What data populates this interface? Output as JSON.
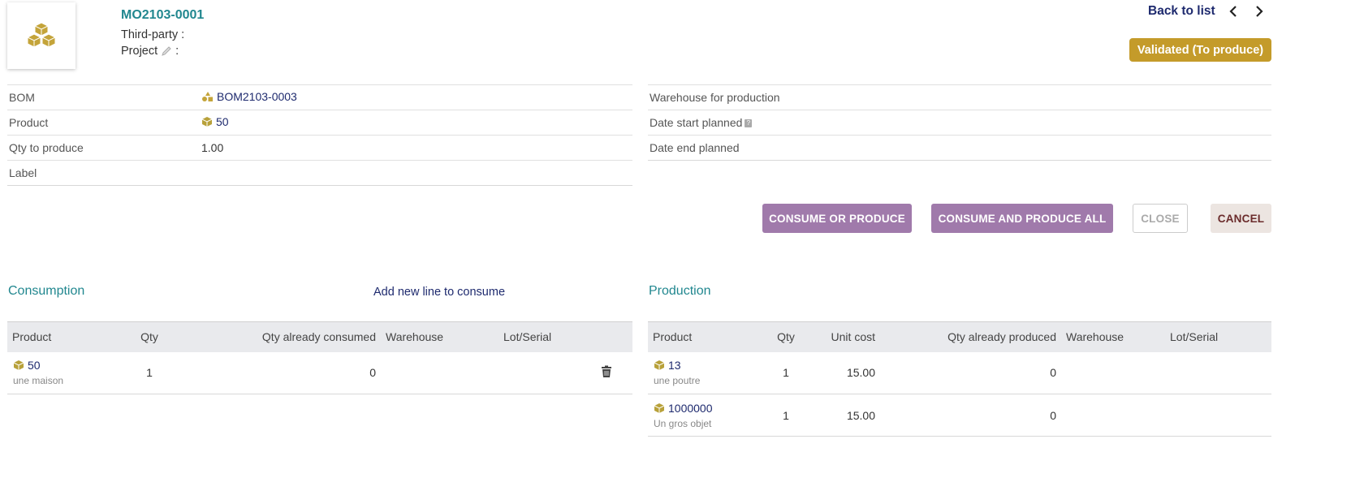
{
  "header": {
    "ref": "MO2103-0001",
    "third_party_label": "Third-party :",
    "project_label": "Project",
    "project_colon": ":",
    "back_to_list": "Back to list",
    "status": "Validated (To produce)"
  },
  "fields_left": {
    "bom": {
      "label": "BOM",
      "value": "BOM2103-0003"
    },
    "product": {
      "label": "Product",
      "value": "50"
    },
    "qty": {
      "label": "Qty to produce",
      "value": "1.00"
    },
    "label": {
      "label": "Label",
      "value": ""
    }
  },
  "fields_right": {
    "warehouse": {
      "label": "Warehouse for production",
      "value": ""
    },
    "date_start": {
      "label": "Date start planned",
      "value": "",
      "help": "?"
    },
    "date_end": {
      "label": "Date end planned",
      "value": ""
    }
  },
  "actions": {
    "consume": "CONSUME OR PRODUCE",
    "consume_all": "CONSUME AND PRODUCE ALL",
    "close": "CLOSE",
    "cancel": "CANCEL"
  },
  "consumption": {
    "title": "Consumption",
    "add_line": "Add new line to consume",
    "headers": {
      "product": "Product",
      "qty": "Qty",
      "consumed": "Qty already consumed",
      "warehouse": "Warehouse",
      "lot": "Lot/Serial"
    },
    "rows": [
      {
        "product": "50",
        "desc": "une maison",
        "qty": "1",
        "consumed": "0",
        "warehouse": "",
        "lot": ""
      }
    ]
  },
  "production": {
    "title": "Production",
    "headers": {
      "product": "Product",
      "qty": "Qty",
      "unit_cost": "Unit cost",
      "produced": "Qty already produced",
      "warehouse": "Warehouse",
      "lot": "Lot/Serial"
    },
    "rows": [
      {
        "product": "13",
        "desc": "une poutre",
        "qty": "1",
        "unit_cost": "15.00",
        "produced": "0",
        "warehouse": "",
        "lot": ""
      },
      {
        "product": "1000000",
        "desc": "Un gros objet",
        "qty": "1",
        "unit_cost": "15.00",
        "produced": "0",
        "warehouse": "",
        "lot": ""
      }
    ]
  },
  "colors": {
    "accent": "#21878f",
    "link": "#1e2a6e",
    "status": "#c49b2a",
    "button": "#a07aab",
    "icon": "#b8a13a"
  }
}
